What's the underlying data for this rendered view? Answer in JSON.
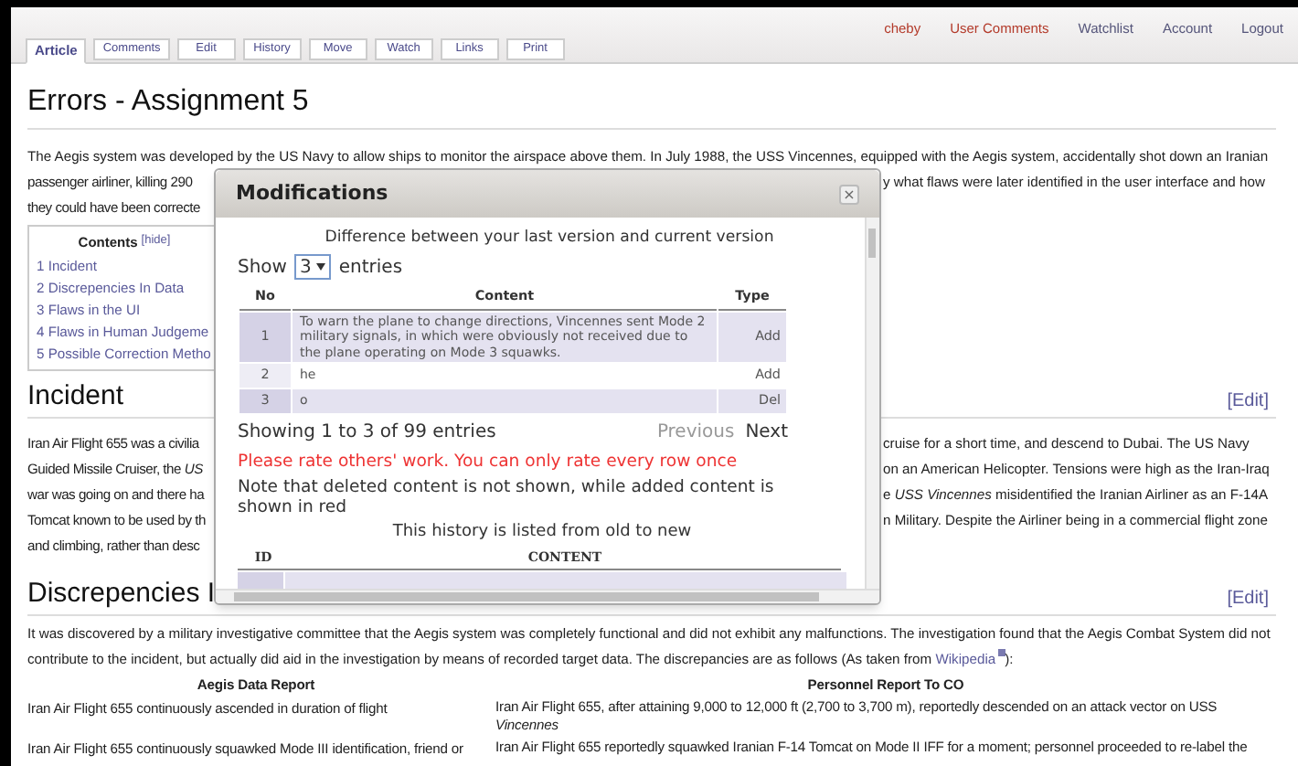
{
  "user_links": [
    {
      "label": "cheby",
      "kind": "new"
    },
    {
      "label": "User Comments",
      "kind": "new"
    },
    {
      "label": "Watchlist",
      "kind": "existing"
    },
    {
      "label": "Account",
      "kind": "existing"
    },
    {
      "label": "Logout",
      "kind": "existing"
    }
  ],
  "tabs": [
    {
      "label": "Article",
      "selected": true
    },
    {
      "label": "Comments",
      "selected": false
    },
    {
      "label": "Edit",
      "selected": false
    },
    {
      "label": "History",
      "selected": false
    },
    {
      "label": "Move",
      "selected": false
    },
    {
      "label": "Watch",
      "selected": false
    },
    {
      "label": "Links",
      "selected": false
    },
    {
      "label": "Print",
      "selected": false
    }
  ],
  "page_title": "Errors - Assignment 5",
  "intro": {
    "line_1": "The Aegis system was developed by the US Navy to allow ships to monitor the airspace above them. In July 1988, the USS Vincennes, equipped with the Aegis system, accidentally shot down an Iranian",
    "lines": [
      {
        "left": "passenger airliner, killing 290",
        "right": "y what flaws were later identified in the user interface and how"
      },
      {
        "left": "they could have been correcte"
      }
    ]
  },
  "contents": {
    "title": "Contents",
    "toggle": "[hide]",
    "items": [
      "1 Incident",
      "2 Discrepencies In Data",
      "3 Flaws in the UI",
      "4 Flaws in Human Judgeme",
      "5 Possible Correction Metho"
    ]
  },
  "incident": {
    "heading": "Incident",
    "edit": "[Edit]",
    "lines": [
      {
        "left": "Iran Air Flight 655 was a civilia",
        "right": "cruise for a short time, and descend to Dubai. The US Navy"
      },
      {
        "left": "Guided Missile Cruiser, the *US*",
        "right": "on an American Helicopter. Tensions were high as the Iran-Iraq"
      },
      {
        "left": "war was going on and there ha",
        "right": "e *USS Vincennes* misidentified the Iranian Airliner as an F-14A"
      },
      {
        "left": "Tomcat known to be used by th",
        "right": "n Military. Despite the Airliner being in a commercial flight zone"
      },
      {
        "left": "and climbing, rather than desc"
      }
    ]
  },
  "discrepencies": {
    "heading": "Discrepencies I",
    "edit": "[Edit]",
    "paragraph": "It was discovered by a military investigative committee that the Aegis system was completely functional and did not exhibit any malfunctions. The investigation found that the Aegis Combat System did not contribute to the incident, but actually did aid in the investigation by means of recorded target data. The discrepancies are as follows (As taken from",
    "link": "Wikipedia",
    "after_link": "):",
    "columns": [
      "Aegis Data Report",
      "Personnel Report To CO"
    ],
    "rows": [
      [
        "Iran Air Flight 655 continuously ascended in duration of flight",
        "Iran Air Flight 655, after attaining 9,000 to 12,000 ft (2,700 to 3,700 m), reportedly descended on an attack vector on USS *Vincennes*"
      ],
      [
        "Iran Air Flight 655 continuously squawked Mode III identification, friend or",
        "Iran Air Flight 655 reportedly squawked Iranian F-14 Tomcat on Mode II IFF for a moment; personnel proceeded to re-label the"
      ]
    ]
  },
  "dialog": {
    "title": "Modifications",
    "close": "×",
    "caption": "Difference between your last version and current version",
    "show_label": "Show",
    "page_size": "3",
    "entries_label": "entries",
    "columns": [
      "No",
      "Content",
      "Type"
    ],
    "rows": [
      {
        "no": "1",
        "content": "To warn the plane to change directions, Vincennes sent Mode 2 military signals, in which were obviously not received due to the plane operating on Mode 3 squawks.",
        "type": "Add"
      },
      {
        "no": "2",
        "content": "he",
        "type": "Add"
      },
      {
        "no": "3",
        "content": "o",
        "type": "Del"
      }
    ],
    "info": "Showing 1 to 3 of 99 entries",
    "pager": [
      {
        "label": "Previous",
        "disabled": true
      },
      {
        "label": "Next",
        "disabled": false
      }
    ],
    "warning": "Please rate others' work. You can only rate every row once",
    "note": "Note that deleted content is not shown, while added content is shown in red",
    "history_caption": "This history is listed from old to new",
    "history_columns": [
      "ID",
      "CONTENT"
    ]
  }
}
